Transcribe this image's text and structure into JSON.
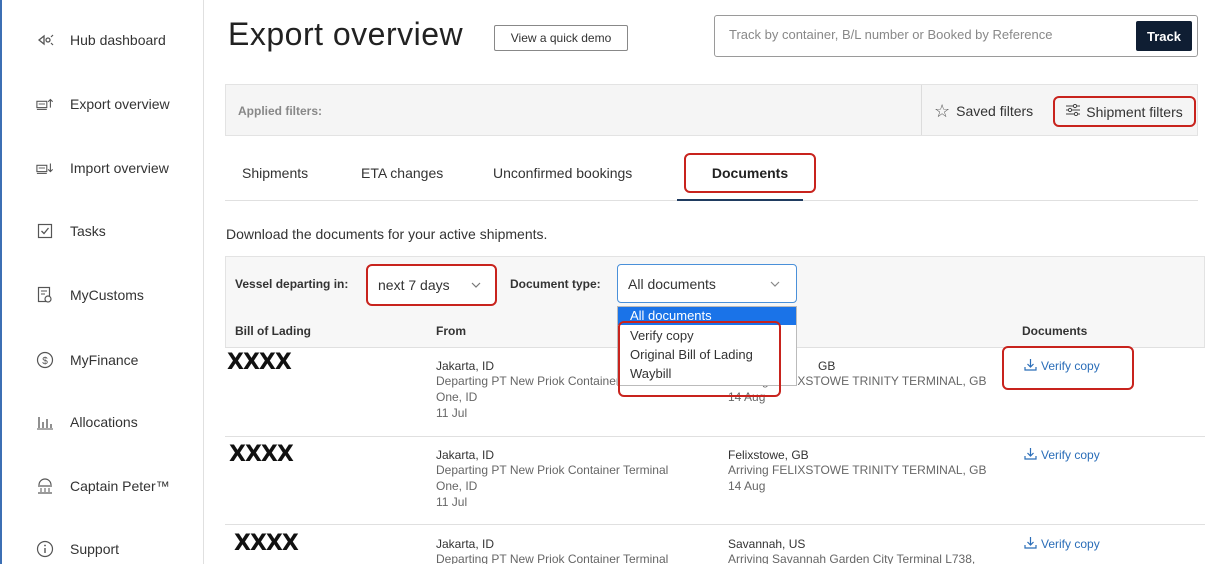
{
  "sidebar": {
    "items": [
      {
        "label": "Hub dashboard",
        "icon": "hub-icon",
        "glyph": "⟬"
      },
      {
        "label": "Export overview",
        "icon": "export-icon",
        "glyph": "⊟"
      },
      {
        "label": "Import overview",
        "icon": "import-icon",
        "glyph": "⊟"
      },
      {
        "label": "Tasks",
        "icon": "tasks-checkbox-icon",
        "glyph": "☑"
      },
      {
        "label": "MyCustoms",
        "icon": "customs-icon",
        "glyph": "⎘"
      },
      {
        "label": "MyFinance",
        "icon": "finance-dollar-icon",
        "glyph": "$"
      },
      {
        "label": "Allocations",
        "icon": "allocations-chart-icon",
        "glyph": "|||"
      },
      {
        "label": "Captain Peter™",
        "icon": "captain-peter-icon",
        "glyph": "⌂"
      },
      {
        "label": "Support",
        "icon": "support-info-icon",
        "glyph": "i"
      }
    ]
  },
  "header": {
    "title": "Export overview",
    "demo_button": "View a quick demo",
    "track_placeholder": "Track by container, B/L number or Booked by Reference",
    "track_button": "Track"
  },
  "filters": {
    "applied_label": "Applied filters:",
    "saved_filters": "Saved filters",
    "shipment_filters": "Shipment filters"
  },
  "tabs": [
    {
      "label": "Shipments"
    },
    {
      "label": "ETA changes"
    },
    {
      "label": "Unconfirmed bookings"
    },
    {
      "label": "Documents"
    }
  ],
  "intro": "Download the documents for your active shipments.",
  "controls": {
    "vessel_label": "Vessel departing in:",
    "vessel_value": "next 7 days",
    "doctype_label": "Document type:",
    "doctype_value": "All documents",
    "doctype_options": [
      "All documents",
      "Verify copy",
      "Original Bill of Lading",
      "Waybill"
    ]
  },
  "table": {
    "headers": {
      "bol": "Bill of Lading",
      "from": "From",
      "documents": "Documents"
    },
    "rows": [
      {
        "bol": "XXXX",
        "from_city": "Jakarta, ID",
        "from_line1": "Departing PT New Priok Container Terminal",
        "from_line2": "One, ID",
        "from_date": "11 Jul",
        "to_city": "GB",
        "to_line1": "Arriving FELIXSTOWE TRINITY TERMINAL, GB",
        "to_date": "14 Aug",
        "doc": "Verify copy"
      },
      {
        "bol": "XXXX",
        "from_city": "Jakarta, ID",
        "from_line1": "Departing PT New Priok Container Terminal",
        "from_line2": "One, ID",
        "from_date": "11 Jul",
        "to_city": "Felixstowe, GB",
        "to_line1": "Arriving FELIXSTOWE TRINITY TERMINAL, GB",
        "to_date": "14 Aug",
        "doc": "Verify copy"
      },
      {
        "bol": "XXXX",
        "from_city": "Jakarta, ID",
        "from_line1": "Departing PT New Priok Container Terminal",
        "to_city": "Savannah, US",
        "to_line1": "Arriving Savannah Garden City Terminal L738,",
        "doc": "Verify copy"
      }
    ]
  },
  "colors": {
    "highlight": "#c8231d",
    "link": "#2a6db8",
    "track_button": "#0f1e33",
    "dropdown_selected": "#1a73e8"
  }
}
